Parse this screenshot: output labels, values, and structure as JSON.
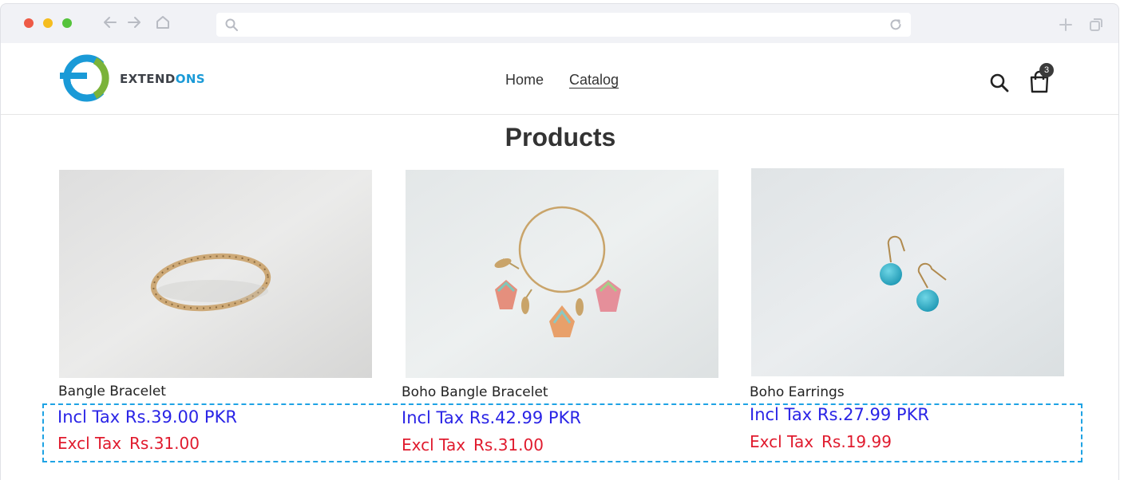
{
  "browser": {
    "address_text": "",
    "icons": [
      "back-arrow-icon",
      "forward-arrow-icon",
      "home-icon",
      "search-icon",
      "reload-icon",
      "new-tab-icon",
      "tabs-icon"
    ]
  },
  "header": {
    "logo": {
      "text_main": "EXTEND",
      "text_accent": "ONS",
      "colors": {
        "blue": "#1a9ad7",
        "green": "#7bb33a",
        "text": "#3d4148"
      }
    },
    "menu": [
      {
        "label": "Home",
        "active": false
      },
      {
        "label": "Catalog",
        "active": true
      }
    ],
    "cart_count": "3"
  },
  "main": {
    "title": "Products",
    "products": [
      {
        "name": "Bangle Bracelet",
        "incl_label": "Incl Tax",
        "incl_price": "Rs.39.00 PKR",
        "excl_label": "Excl Tax",
        "excl_price": "Rs.31.00"
      },
      {
        "name": "Boho Bangle Bracelet",
        "incl_label": "Incl Tax",
        "incl_price": "Rs.42.99 PKR",
        "excl_label": "Excl Tax",
        "excl_price": "Rs.31.00"
      },
      {
        "name": "Boho Earrings",
        "incl_label": "Incl Tax",
        "incl_price": "Rs.27.99 PKR",
        "excl_label": "Excl Tax",
        "excl_price": "Rs.19.99"
      }
    ]
  },
  "colors": {
    "incl_price": "#2a24e6",
    "excl_price": "#e01b2e",
    "highlight_border": "#1fa3e4"
  }
}
